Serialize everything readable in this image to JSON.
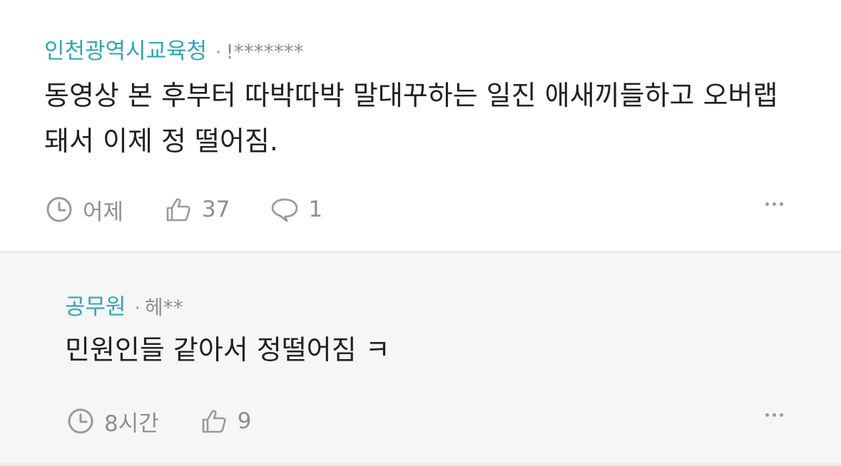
{
  "comments": [
    {
      "author": "인천광역시교육청",
      "separator": "·",
      "user": "!*******",
      "text": "동영상 본 후부터 따박따박 말대꾸하는 일진 애새끼들하고 오버랩돼서 이제 정 떨어짐.",
      "time": "어제",
      "likes": "37",
      "replies": "1",
      "icons": {
        "time": "clock-icon",
        "like": "thumbs-up-icon",
        "reply": "speech-bubble-icon",
        "more": "more-dots-icon"
      }
    }
  ],
  "reply": {
    "author": "공무원",
    "separator": "·",
    "user": "헤**",
    "text": "민원인들 같아서 정떨어짐 ㅋ",
    "time": "8시간",
    "likes": "9",
    "icons": {
      "time": "clock-icon",
      "like": "thumbs-up-icon",
      "more": "more-dots-icon"
    }
  },
  "colors": {
    "author": "#2fa6b8",
    "meta": "#8e8e8e",
    "body": "#222222",
    "reply_background": "#f6f6f6"
  }
}
